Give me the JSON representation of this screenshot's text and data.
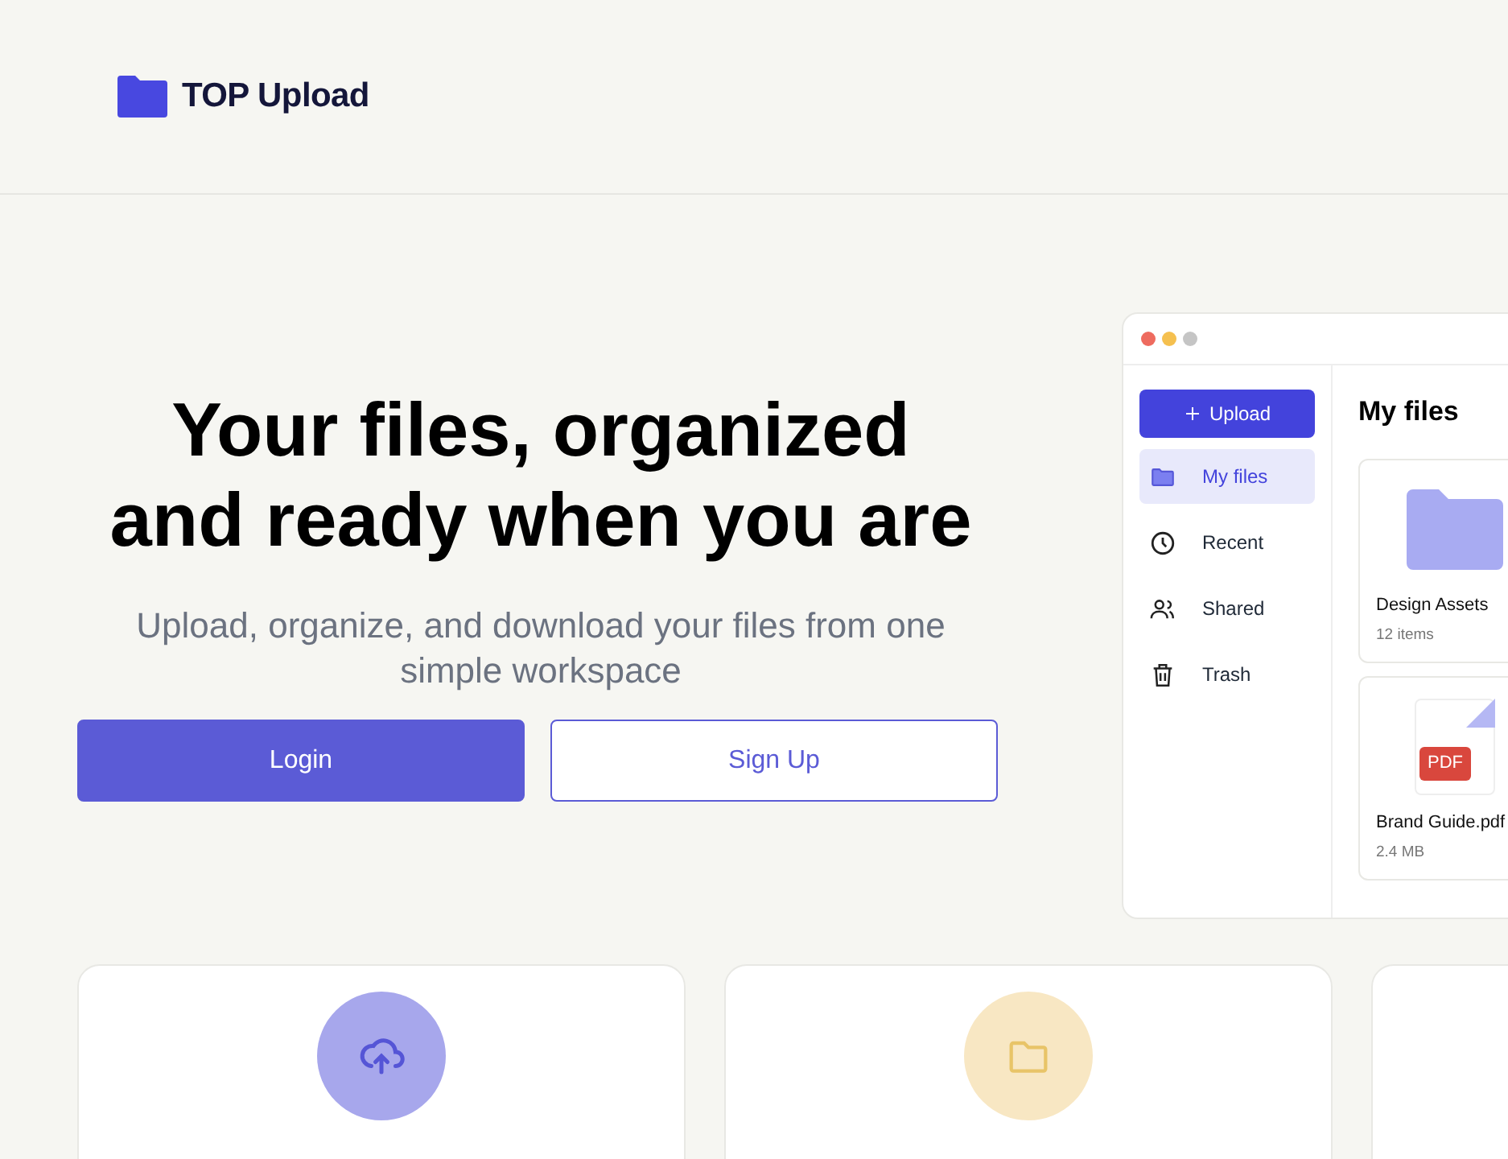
{
  "brand": {
    "name": "TOP Upload"
  },
  "hero": {
    "title_lines": [
      "Your files, organized",
      "and ready when you are"
    ],
    "subtitle": "Upload, organize, and download your files from one simple workspace",
    "buttons": [
      {
        "label": "Login",
        "kind": "primary"
      },
      {
        "label": "Sign Up",
        "kind": "outline"
      }
    ]
  },
  "mockup": {
    "upload_label": "Upload",
    "nav": [
      {
        "label": "My files",
        "kind": "folder",
        "selected": true
      },
      {
        "label": "Recent",
        "kind": "clock",
        "selected": false
      },
      {
        "label": "Shared",
        "kind": "users",
        "selected": false
      },
      {
        "label": "Trash",
        "kind": "trash",
        "selected": false
      }
    ],
    "heading": "My files",
    "files": [
      {
        "kind": "folder",
        "name": "Design Assets",
        "meta": "12 items"
      },
      {
        "kind": "pdf",
        "badge": "PDF",
        "name": "Brand Guide.pdf",
        "meta": "2.4 MB"
      }
    ]
  },
  "features": [
    {
      "kind": "upload",
      "color": "#a7a7ec"
    },
    {
      "kind": "folder",
      "color": "#f8e7c3"
    }
  ]
}
